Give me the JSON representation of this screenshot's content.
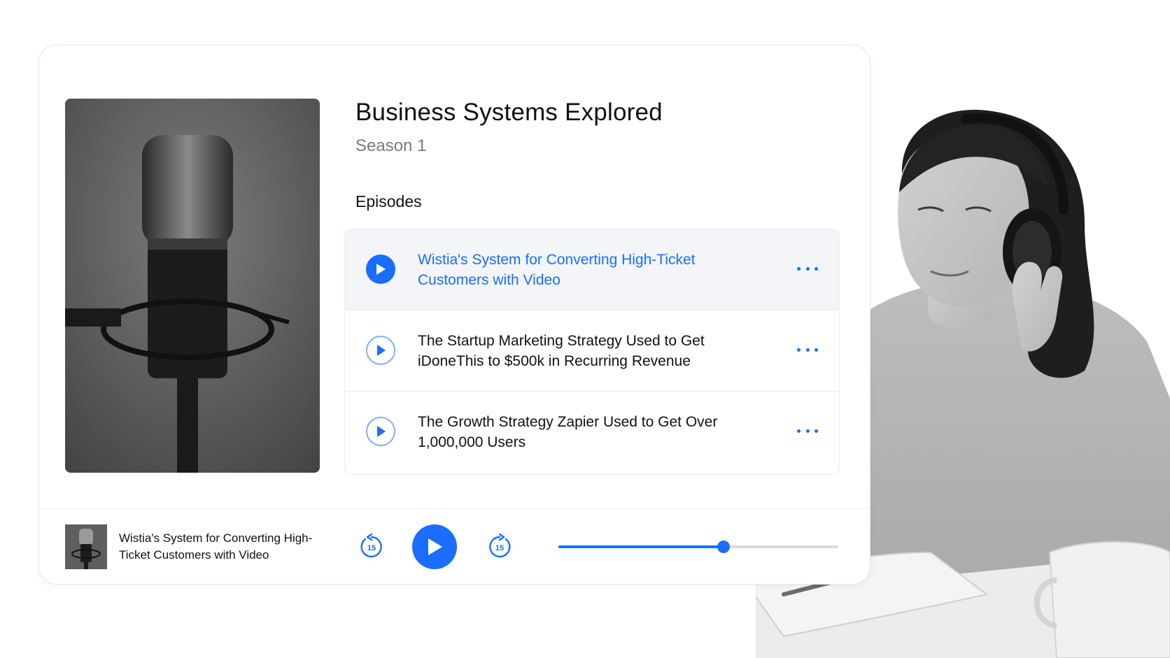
{
  "show": {
    "title": "Business Systems Explored",
    "season": "Season 1",
    "episodes_heading": "Episodes"
  },
  "episodes": [
    {
      "title": "Wistia's System for Converting High-Ticket Customers with Video",
      "active": true
    },
    {
      "title": "The Startup Marketing Strategy Used to Get iDoneThis to $500k in Recurring Revenue",
      "active": false
    },
    {
      "title": "The Growth Strategy Zapier Used to Get Over 1,000,000 Users",
      "active": false
    }
  ],
  "player": {
    "now_playing": "Wistia's System for Converting High-Ticket Customers with Video",
    "skip_back_seconds": "15",
    "skip_forward_seconds": "15",
    "progress_fraction": 0.59
  },
  "colors": {
    "accent": "#1a6dff",
    "active_row_bg": "#f3f5f8",
    "track": "#d9d9d9"
  },
  "icons": {
    "episode_play": "play-icon",
    "episode_more": "more-horizontal-icon",
    "skip_back": "rewind-15-icon",
    "skip_forward": "forward-15-icon",
    "main_play": "play-icon"
  }
}
